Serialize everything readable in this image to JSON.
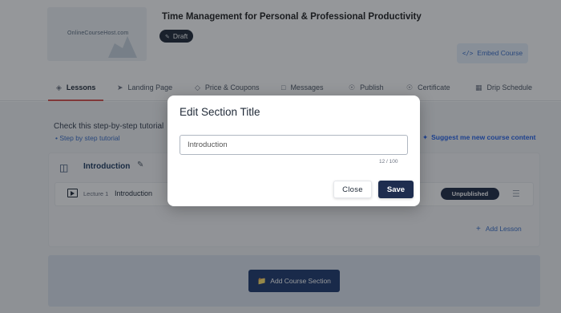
{
  "course": {
    "thumbnail_text": "OnlineCourseHost.com",
    "title": "Time Management for Personal & Professional Productivity",
    "status_badge": "Draft",
    "embed_button": "Embed Course"
  },
  "tabs": [
    {
      "label": "Lessons",
      "icon": "lessons-icon",
      "active": true
    },
    {
      "label": "Landing Page",
      "icon": "rocket-icon"
    },
    {
      "label": "Price & Coupons",
      "icon": "tag-icon"
    },
    {
      "label": "Messages",
      "icon": "message-icon"
    },
    {
      "label": "Publish",
      "icon": "globe-icon"
    },
    {
      "label": "Certificate",
      "icon": "certificate-icon"
    },
    {
      "label": "Drip Schedule",
      "icon": "calendar-icon"
    }
  ],
  "tutorial": {
    "text": "Check this step-by-step tutorial",
    "link": "Step by step tutorial"
  },
  "suggest_link": "Suggest me new course content",
  "section": {
    "title": "Introduction",
    "lecture": {
      "number": "Lecture 1",
      "title": "Introduction",
      "status": "Unpublished"
    },
    "add_lesson": "Add Lesson"
  },
  "add_section_button": "Add Course Section",
  "modal": {
    "title": "Edit Section Title",
    "input_value": "Introduction",
    "char_count": "12 / 100",
    "close_label": "Close",
    "save_label": "Save"
  },
  "colors": {
    "accent_blue": "#1e2d4f",
    "tab_underline": "#d9534f",
    "link_blue": "#3b6fc8"
  }
}
